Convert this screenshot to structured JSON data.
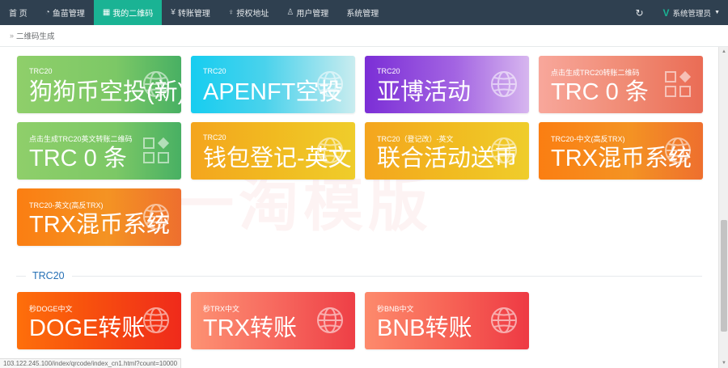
{
  "nav": {
    "items": [
      {
        "label": "首 页",
        "icon": "home",
        "glyph": ""
      },
      {
        "label": "鱼苗管理",
        "icon": "dashboard-icon",
        "glyph": "◔"
      },
      {
        "label": "我的二维码",
        "icon": "qrcode-icon",
        "glyph": "▦",
        "active": true
      },
      {
        "label": "转账管理",
        "icon": "yen-icon",
        "glyph": "¥"
      },
      {
        "label": "授权地址",
        "icon": "bulb-icon",
        "glyph": "♀"
      },
      {
        "label": "用户管理",
        "icon": "user-icon",
        "glyph": "♙"
      },
      {
        "label": "系统管理",
        "icon": "settings",
        "glyph": ""
      }
    ],
    "refresh_glyph": "↻",
    "user": {
      "logo": "V",
      "name": "系统管理员",
      "caret": "▼"
    }
  },
  "breadcrumb": {
    "arrows": "»",
    "label": "二维码生成"
  },
  "watermark": "一淘模版",
  "cards": [
    {
      "sub": "TRC20",
      "big": "狗狗币空投(新)",
      "gradient": "g-green",
      "icon": "globe-icon"
    },
    {
      "sub": "TRC20",
      "big": "APENFT空投",
      "gradient": "g-cyan",
      "icon": "globe-icon"
    },
    {
      "sub": "TRC20",
      "big": "亚博活动",
      "gradient": "g-purple",
      "icon": "globe-icon"
    },
    {
      "sub": "点击生成TRC20转账二维码",
      "big": "TRC 0 条",
      "gradient": "g-salmon",
      "icon": "qrcode-icon"
    },
    {
      "sub": "点击生成TRC20英文转账二维码",
      "big": "TRC 0 条",
      "gradient": "g-green",
      "icon": "qrcode-icon"
    },
    {
      "sub": "TRC20",
      "big": "钱包登记-英文",
      "gradient": "g-yellow",
      "icon": "globe-icon"
    },
    {
      "sub": "TRC20（登记改）-英文",
      "big": "联合活动送币",
      "gradient": "g-yellow",
      "icon": "globe-icon"
    },
    {
      "sub": "TRC20-中文(高反TRX)",
      "big": "TRX混币系统",
      "gradient": "g-orange",
      "icon": "globe-icon"
    },
    {
      "sub": "TRC20-英文(高反TRX)",
      "big": "TRX混币系统",
      "gradient": "g-orange",
      "icon": "globe-icon"
    }
  ],
  "section": {
    "label": "TRC20"
  },
  "cards2": [
    {
      "sub": "秒DOGE中文",
      "big": "DOGE转账",
      "gradient": "g-red",
      "icon": "globe-icon"
    },
    {
      "sub": "秒TRX中文",
      "big": "TRX转账",
      "gradient": "g-pink",
      "icon": "globe-icon"
    },
    {
      "sub": "秒BNB中文",
      "big": "BNB转账",
      "gradient": "g-pink2",
      "icon": "globe-icon"
    }
  ],
  "statusbar": "103.122.245.100/index/qrcode/index_cn1.html?count=10000"
}
